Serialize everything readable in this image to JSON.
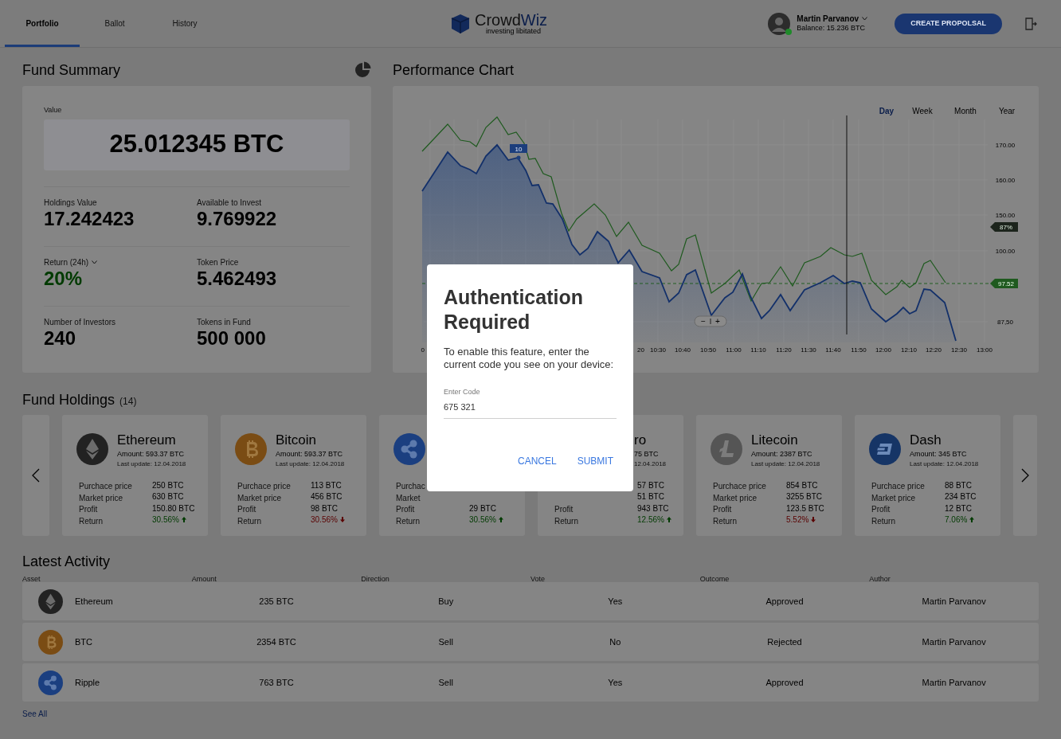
{
  "header": {
    "tabs": [
      {
        "label": "Portfolio",
        "selected": true
      },
      {
        "label": "Ballot",
        "selected": false
      },
      {
        "label": "History",
        "selected": false
      }
    ],
    "logo": {
      "wordmark_lead": "Crowd",
      "wordmark_accent": "Wiz",
      "tagline": "investing libitated"
    },
    "user": {
      "name": "Martin Parvanov",
      "balance": "Balance: 15.236 BTC",
      "online": true
    },
    "create_button": "CREATE PROPOLSAL"
  },
  "fund_summary": {
    "title": "Fund Summary",
    "value_label": "Value",
    "value": "25.012345 BTC",
    "stats": [
      {
        "label": "Holdings Value",
        "value": "17.242423",
        "positive": false,
        "dropdown": false
      },
      {
        "label": "Available to Invest",
        "value": "9.769922",
        "positive": false,
        "dropdown": false
      },
      {
        "label": "Return (24h)",
        "value": "20%",
        "positive": true,
        "dropdown": true
      },
      {
        "label": "Token Price",
        "value": "5.462493",
        "positive": false,
        "dropdown": false
      },
      {
        "label": "Number of Investors",
        "value": "240",
        "positive": false,
        "dropdown": false
      },
      {
        "label": "Tokens in Fund",
        "value": "500 000",
        "positive": false,
        "dropdown": false
      }
    ]
  },
  "performance_chart": {
    "title": "Performance Chart",
    "ranges": [
      {
        "label": "Day",
        "selected": true
      },
      {
        "label": "Week",
        "selected": false
      },
      {
        "label": "Month",
        "selected": false
      },
      {
        "label": "Year",
        "selected": false
      }
    ],
    "y_axis_labels": [
      "170.00",
      "160.00",
      "150.00",
      "100.00",
      "87,50"
    ],
    "x_axis_labels": [
      "0",
      "20",
      "10:30",
      "10:40",
      "10:50",
      "11:00",
      "11:10",
      "11:20",
      "11:30",
      "11:40",
      "11:50",
      "12:00",
      "12:10",
      "12:20",
      "12:30",
      "13:00"
    ],
    "point_tag": "10",
    "upper_tag": "87%",
    "current_tag": "97.52",
    "zoom_out": "−",
    "zoom_in": "+"
  },
  "fund_holdings": {
    "title": "Fund Holdings",
    "count": "(14)",
    "cards": [
      {
        "kind": "ethereum",
        "name": "Ethereum",
        "amount": "Amount: 593.37 BTC",
        "updated": "Last update: 12.04.2018",
        "clipped_left": false,
        "rows": [
          {
            "label": "Purchace price",
            "value": "250 BTC"
          },
          {
            "label": "Market price",
            "value": "630 BTC"
          },
          {
            "label": "Profit",
            "value": "150.80 BTC"
          },
          {
            "label": "Return",
            "value": "30.56%",
            "rising": true
          }
        ]
      },
      {
        "kind": "bitcoin",
        "name": "Bitcoin",
        "amount": "Amount: 593.37 BTC",
        "updated": "Last update: 12.04.2018",
        "clipped_left": false,
        "rows": [
          {
            "label": "Purchace price",
            "value": "113 BTC"
          },
          {
            "label": "Market price",
            "value": "456 BTC"
          },
          {
            "label": "Profit",
            "value": "98 BTC"
          },
          {
            "label": "Return",
            "value": "30.56%",
            "rising": false
          }
        ]
      },
      {
        "kind": "ripple",
        "clipped_left": false,
        "rows": [
          {
            "label": "Purchac"
          },
          {
            "label": "Market"
          },
          {
            "label": "Profit",
            "value": "29 BTC"
          },
          {
            "label": "Return",
            "value": "30.56%",
            "rising": true
          }
        ]
      },
      {
        "name": "ro",
        "amount": "75 BTC",
        "updated": "12.04.2018",
        "clipped_left": true,
        "rows": [
          {
            "value": "57 BTC"
          },
          {
            "value": "51 BTC"
          },
          {
            "label": "Profit",
            "value": "943 BTC"
          },
          {
            "label": "Return",
            "value": "12.56%",
            "rising": true
          }
        ]
      },
      {
        "kind": "litecoin",
        "name": "Litecoin",
        "amount": "Amount: 2387 BTC",
        "updated": "Last update: 12.04.2018",
        "clipped_left": false,
        "rows": [
          {
            "label": "Purchace price",
            "value": "854 BTC"
          },
          {
            "label": "Market price",
            "value": "3255 BTC"
          },
          {
            "label": "Profit",
            "value": "123.5 BTC"
          },
          {
            "label": "Return",
            "value": "5.52%",
            "rising": false
          }
        ]
      },
      {
        "kind": "dash",
        "name": "Dash",
        "amount": "Amount: 345 BTC",
        "updated": "Last update: 12.04.2018",
        "clipped_left": false,
        "rows": [
          {
            "label": "Purchace price",
            "value": "88 BTC"
          },
          {
            "label": "Market price",
            "value": "234 BTC"
          },
          {
            "label": "Profit",
            "value": "12 BTC"
          },
          {
            "label": "Return",
            "value": "7.06%",
            "rising": true
          }
        ]
      }
    ]
  },
  "latest_activity": {
    "title": "Latest Activity",
    "columns": [
      "Asset",
      "Amount",
      "Direction",
      "Vote",
      "Outcome",
      "Author"
    ],
    "rows": [
      {
        "kind": "ethereum",
        "cells": [
          "Ethereum",
          "235 BTC",
          "Buy",
          "Yes",
          "Approved",
          "Martin Parvanov"
        ]
      },
      {
        "kind": "bitcoin",
        "cells": [
          "BTC",
          "2354 BTC",
          "Sell",
          "No",
          "Rejected",
          "Martin Parvanov"
        ]
      },
      {
        "kind": "ripple",
        "cells": [
          "Ripple",
          "763 BTC",
          "Sell",
          "Yes",
          "Approved",
          "Martin Parvanov"
        ]
      }
    ],
    "see_all": "See All"
  },
  "dialog": {
    "title": "Authentication Required",
    "message": "To enable this feature, enter the current code you see on your device:",
    "field_label": "Enter Code",
    "field_value": "675 321",
    "buttons": [
      "CANCEL",
      "SUBMIT"
    ]
  }
}
